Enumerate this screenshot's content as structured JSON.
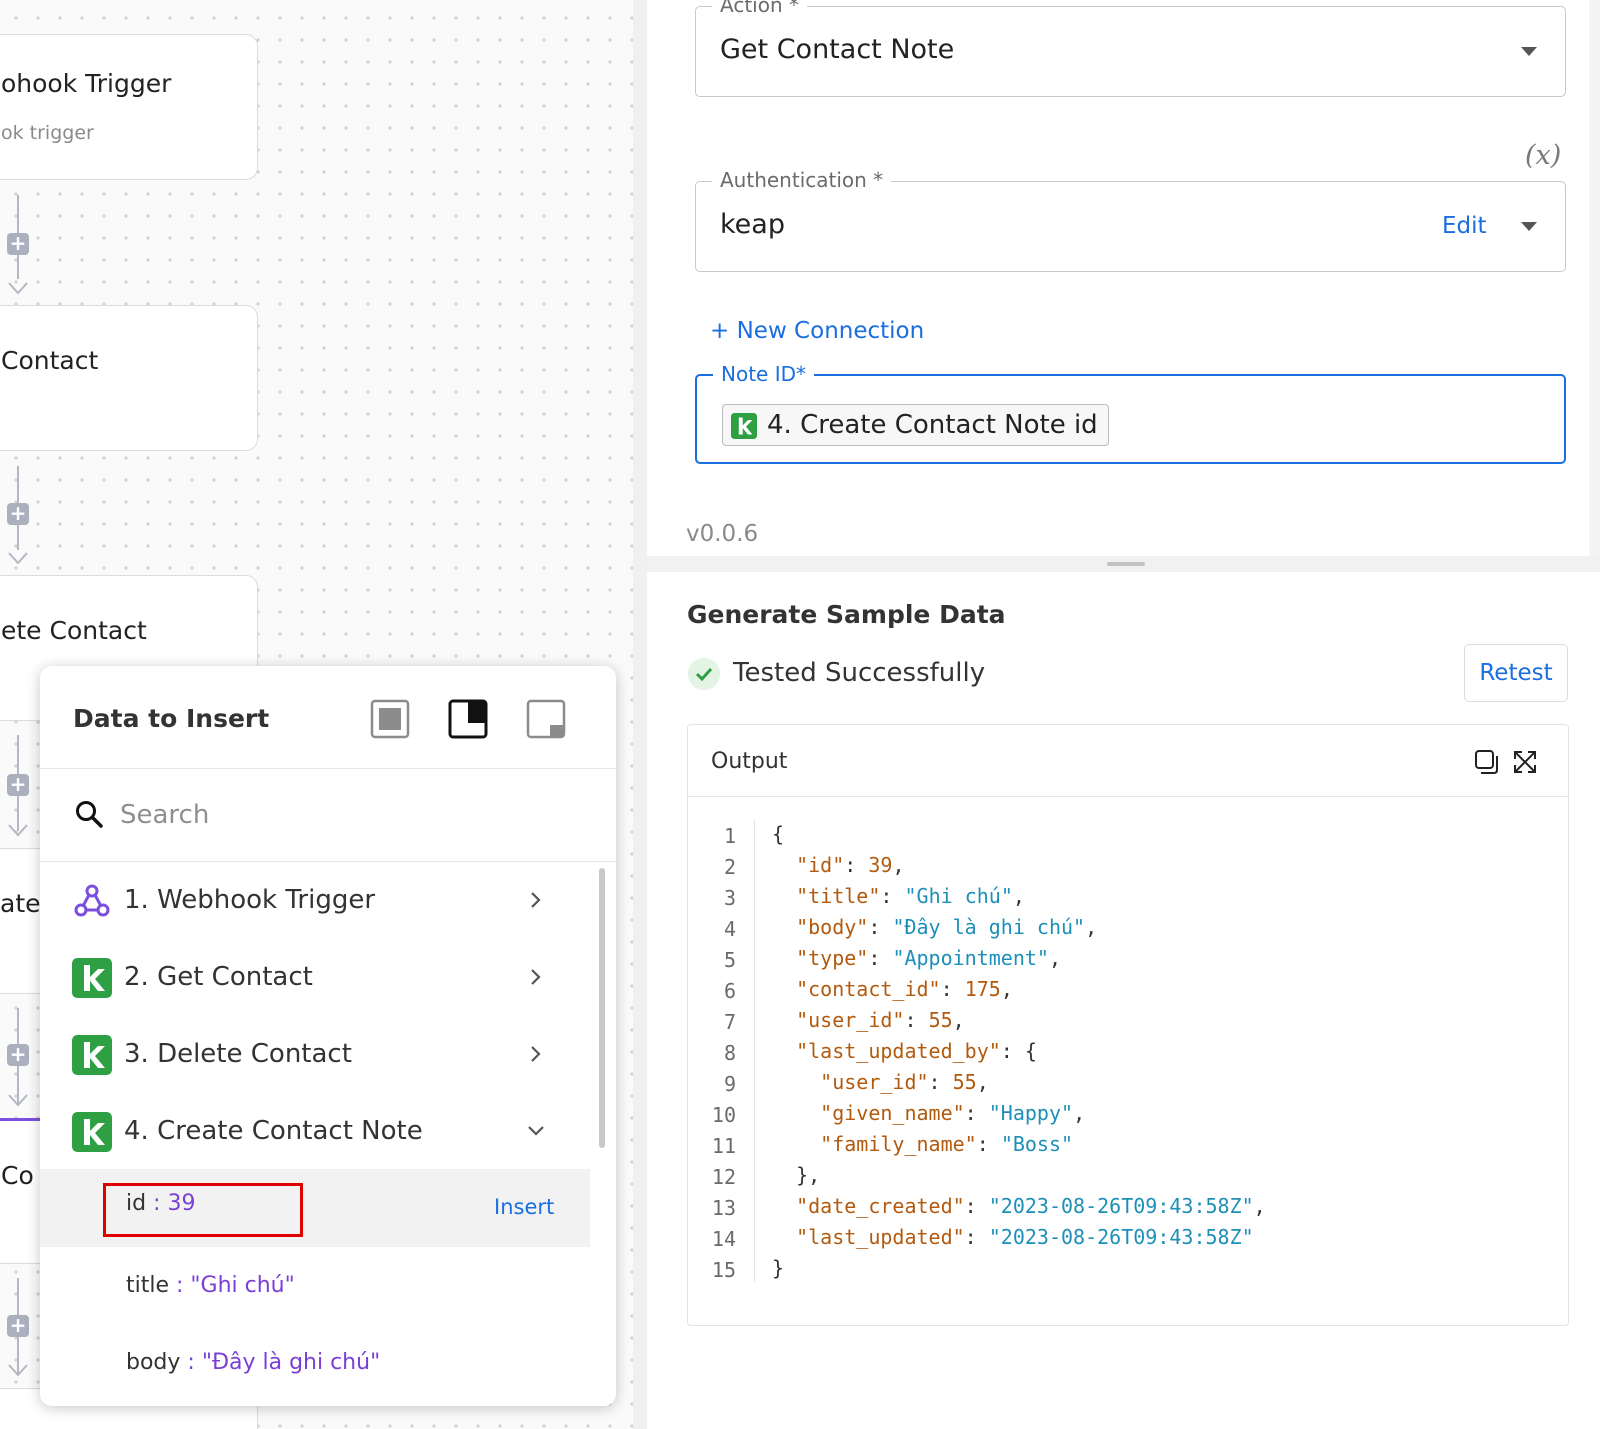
{
  "canvas": {
    "nodes": [
      {
        "title": "ohook Trigger",
        "subtitle": "ok trigger"
      },
      {
        "title": "Contact",
        "subtitle": ""
      },
      {
        "title": "ete Contact",
        "subtitle": ""
      }
    ],
    "partial_labels": [
      "ate",
      "Co"
    ]
  },
  "popup": {
    "title": "Data to Insert",
    "search_placeholder": "Search",
    "steps": [
      {
        "label": "1. Webhook Trigger",
        "icon": "webhook-icon",
        "expanded": false
      },
      {
        "label": "2. Get Contact",
        "icon": "keap-icon",
        "expanded": false
      },
      {
        "label": "3. Delete Contact",
        "icon": "keap-icon",
        "expanded": false
      },
      {
        "label": "4. Create Contact Note",
        "icon": "keap-icon",
        "expanded": true
      }
    ],
    "fields": [
      {
        "key": "id",
        "sep": " : ",
        "value": "39"
      },
      {
        "key": "title",
        "sep": " : ",
        "value": "\"Ghi chú\""
      },
      {
        "key": "body",
        "sep": " : ",
        "value": "\"Đây là ghi chú\""
      }
    ],
    "insert_label": "Insert"
  },
  "settings": {
    "action": {
      "label": "Action *",
      "value": "Get Contact Note"
    },
    "variable_toggle": "(x)",
    "auth": {
      "label": "Authentication *",
      "value": "keap",
      "edit_label": "Edit"
    },
    "new_connection": "+ New Connection",
    "note_id": {
      "label": "Note ID*",
      "chip": "4. Create Contact Note id"
    },
    "version": "v0.0.6"
  },
  "sample": {
    "title": "Generate Sample Data",
    "status": "Tested Successfully",
    "retest": "Retest",
    "output_title": "Output"
  },
  "code_lines": [
    [
      {
        "t": "p",
        "v": "{"
      }
    ],
    [
      {
        "t": "p",
        "v": "  "
      },
      {
        "t": "k",
        "v": "\"id\""
      },
      {
        "t": "p",
        "v": ": "
      },
      {
        "t": "n",
        "v": "39"
      },
      {
        "t": "p",
        "v": ","
      }
    ],
    [
      {
        "t": "p",
        "v": "  "
      },
      {
        "t": "k",
        "v": "\"title\""
      },
      {
        "t": "p",
        "v": ": "
      },
      {
        "t": "s",
        "v": "\"Ghi chú\""
      },
      {
        "t": "p",
        "v": ","
      }
    ],
    [
      {
        "t": "p",
        "v": "  "
      },
      {
        "t": "k",
        "v": "\"body\""
      },
      {
        "t": "p",
        "v": ": "
      },
      {
        "t": "s",
        "v": "\"Đây là ghi chú\""
      },
      {
        "t": "p",
        "v": ","
      }
    ],
    [
      {
        "t": "p",
        "v": "  "
      },
      {
        "t": "k",
        "v": "\"type\""
      },
      {
        "t": "p",
        "v": ": "
      },
      {
        "t": "s",
        "v": "\"Appointment\""
      },
      {
        "t": "p",
        "v": ","
      }
    ],
    [
      {
        "t": "p",
        "v": "  "
      },
      {
        "t": "k",
        "v": "\"contact_id\""
      },
      {
        "t": "p",
        "v": ": "
      },
      {
        "t": "n",
        "v": "175"
      },
      {
        "t": "p",
        "v": ","
      }
    ],
    [
      {
        "t": "p",
        "v": "  "
      },
      {
        "t": "k",
        "v": "\"user_id\""
      },
      {
        "t": "p",
        "v": ": "
      },
      {
        "t": "n",
        "v": "55"
      },
      {
        "t": "p",
        "v": ","
      }
    ],
    [
      {
        "t": "p",
        "v": "  "
      },
      {
        "t": "k",
        "v": "\"last_updated_by\""
      },
      {
        "t": "p",
        "v": ": {"
      }
    ],
    [
      {
        "t": "p",
        "v": "    "
      },
      {
        "t": "k",
        "v": "\"user_id\""
      },
      {
        "t": "p",
        "v": ": "
      },
      {
        "t": "n",
        "v": "55"
      },
      {
        "t": "p",
        "v": ","
      }
    ],
    [
      {
        "t": "p",
        "v": "    "
      },
      {
        "t": "k",
        "v": "\"given_name\""
      },
      {
        "t": "p",
        "v": ": "
      },
      {
        "t": "s",
        "v": "\"Happy\""
      },
      {
        "t": "p",
        "v": ","
      }
    ],
    [
      {
        "t": "p",
        "v": "    "
      },
      {
        "t": "k",
        "v": "\"family_name\""
      },
      {
        "t": "p",
        "v": ": "
      },
      {
        "t": "s",
        "v": "\"Boss\""
      }
    ],
    [
      {
        "t": "p",
        "v": "  },"
      }
    ],
    [
      {
        "t": "p",
        "v": "  "
      },
      {
        "t": "k",
        "v": "\"date_created\""
      },
      {
        "t": "p",
        "v": ": "
      },
      {
        "t": "s",
        "v": "\"2023-08-26T09:43:58Z\""
      },
      {
        "t": "p",
        "v": ","
      }
    ],
    [
      {
        "t": "p",
        "v": "  "
      },
      {
        "t": "k",
        "v": "\"last_updated\""
      },
      {
        "t": "p",
        "v": ": "
      },
      {
        "t": "s",
        "v": "\"2023-08-26T09:43:58Z\""
      }
    ],
    [
      {
        "t": "p",
        "v": "}"
      }
    ]
  ],
  "colors": {
    "accent": "#1a6ee0",
    "keap_green": "#2ea043",
    "webhook_purple": "#7b4fe0",
    "highlight_red": "#e00000",
    "success_green": "#2e9e44"
  }
}
